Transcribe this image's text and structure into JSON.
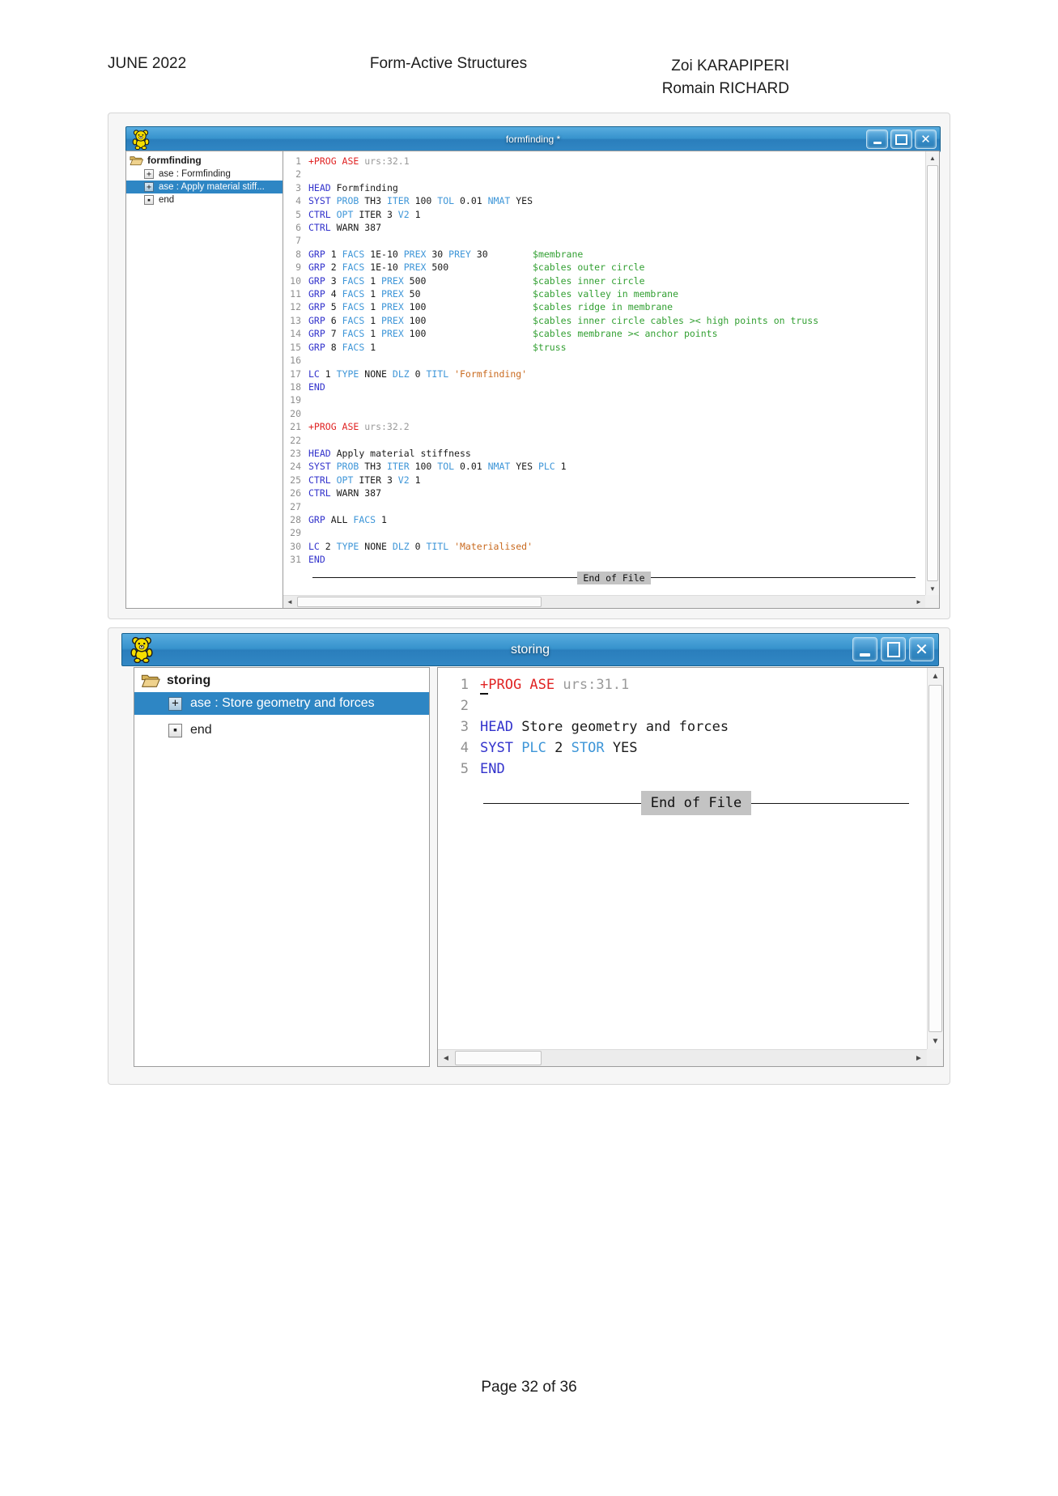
{
  "header": {
    "date": "JUNE 2022",
    "title": "Form-Active Structures",
    "authors": [
      "Zoi KARAPIPERI",
      "Romain RICHARD"
    ]
  },
  "footer": "Page 32 of 36",
  "colors": {
    "titlebar_blue": "#3793cd",
    "selection_blue": "#2e86c4",
    "keyword_primary_blue": "#3333cc",
    "keyword_secondary_blue": "#3e96d8",
    "comment_green": "#33a033",
    "string_orange": "#c96a1f",
    "prog_red": "#e02424",
    "line_number_gray": "#8f8f8f"
  },
  "windows": [
    {
      "title": "formfinding *",
      "controls": [
        "minimize",
        "maximize",
        "close"
      ],
      "eof_label": "End of File",
      "tree": {
        "root": "formfinding",
        "items": [
          {
            "type": "plus",
            "label": "ase : Formfinding",
            "selected": false
          },
          {
            "type": "plus",
            "label": "ase : Apply material stiff...",
            "selected": true
          },
          {
            "type": "dot",
            "label": "end",
            "selected": false
          }
        ]
      },
      "code": [
        {
          "n": 1,
          "t": [
            [
              "+PROG ASE",
              "rd"
            ],
            [
              " urs:32.1",
              "gy"
            ]
          ]
        },
        {
          "n": 2,
          "t": []
        },
        {
          "n": 3,
          "t": [
            [
              "HEAD",
              "k1"
            ],
            [
              " Formfinding",
              "v"
            ]
          ]
        },
        {
          "n": 4,
          "t": [
            [
              "SYST",
              "k1"
            ],
            [
              " PROB",
              "k2"
            ],
            [
              " TH3",
              "v"
            ],
            [
              " ITER",
              "k2"
            ],
            [
              " 100",
              "v"
            ],
            [
              " TOL",
              "k2"
            ],
            [
              " 0.01",
              "v"
            ],
            [
              " NMAT",
              "k2"
            ],
            [
              " YES",
              "v"
            ]
          ]
        },
        {
          "n": 5,
          "t": [
            [
              "CTRL",
              "k1"
            ],
            [
              " OPT",
              "k2"
            ],
            [
              " ITER 3",
              "v"
            ],
            [
              " V2",
              "k2"
            ],
            [
              " 1",
              "v"
            ]
          ]
        },
        {
          "n": 6,
          "t": [
            [
              "CTRL",
              "k1"
            ],
            [
              " WARN 387",
              "v"
            ]
          ]
        },
        {
          "n": 7,
          "t": []
        },
        {
          "n": 8,
          "t": [
            [
              "GRP",
              "k1"
            ],
            [
              " 1",
              "v"
            ],
            [
              " FACS",
              "k2"
            ],
            [
              " 1E-10",
              "v"
            ],
            [
              " PREX",
              "k2"
            ],
            [
              " 30",
              "v"
            ],
            [
              " PREY",
              "k2"
            ],
            [
              " 30",
              "v"
            ],
            [
              "        ",
              "v"
            ],
            [
              "$membrane",
              "gr"
            ]
          ]
        },
        {
          "n": 9,
          "t": [
            [
              "GRP",
              "k1"
            ],
            [
              " 2",
              "v"
            ],
            [
              " FACS",
              "k2"
            ],
            [
              " 1E-10",
              "v"
            ],
            [
              " PREX",
              "k2"
            ],
            [
              " 500",
              "v"
            ],
            [
              "               ",
              "v"
            ],
            [
              "$cables outer circle",
              "gr"
            ]
          ]
        },
        {
          "n": 10,
          "t": [
            [
              "GRP",
              "k1"
            ],
            [
              " 3",
              "v"
            ],
            [
              " FACS",
              "k2"
            ],
            [
              " 1",
              "v"
            ],
            [
              " PREX",
              "k2"
            ],
            [
              " 500",
              "v"
            ],
            [
              "                   ",
              "v"
            ],
            [
              "$cables inner circle",
              "gr"
            ]
          ]
        },
        {
          "n": 11,
          "t": [
            [
              "GRP",
              "k1"
            ],
            [
              " 4",
              "v"
            ],
            [
              " FACS",
              "k2"
            ],
            [
              " 1",
              "v"
            ],
            [
              " PREX",
              "k2"
            ],
            [
              " 50",
              "v"
            ],
            [
              "                    ",
              "v"
            ],
            [
              "$cables valley in membrane",
              "gr"
            ]
          ]
        },
        {
          "n": 12,
          "t": [
            [
              "GRP",
              "k1"
            ],
            [
              " 5",
              "v"
            ],
            [
              " FACS",
              "k2"
            ],
            [
              " 1",
              "v"
            ],
            [
              " PREX",
              "k2"
            ],
            [
              " 100",
              "v"
            ],
            [
              "                   ",
              "v"
            ],
            [
              "$cables ridge in membrane",
              "gr"
            ]
          ]
        },
        {
          "n": 13,
          "t": [
            [
              "GRP",
              "k1"
            ],
            [
              " 6",
              "v"
            ],
            [
              " FACS",
              "k2"
            ],
            [
              " 1",
              "v"
            ],
            [
              " PREX",
              "k2"
            ],
            [
              " 100",
              "v"
            ],
            [
              "                   ",
              "v"
            ],
            [
              "$cables inner circle cables >< high points on truss",
              "gr"
            ]
          ]
        },
        {
          "n": 14,
          "t": [
            [
              "GRP",
              "k1"
            ],
            [
              " 7",
              "v"
            ],
            [
              " FACS",
              "k2"
            ],
            [
              " 1",
              "v"
            ],
            [
              " PREX",
              "k2"
            ],
            [
              " 100",
              "v"
            ],
            [
              "                   ",
              "v"
            ],
            [
              "$cables membrane >< anchor points",
              "gr"
            ]
          ]
        },
        {
          "n": 15,
          "t": [
            [
              "GRP",
              "k1"
            ],
            [
              " 8",
              "v"
            ],
            [
              " FACS",
              "k2"
            ],
            [
              " 1",
              "v"
            ],
            [
              "                            ",
              "v"
            ],
            [
              "$truss",
              "gr"
            ]
          ]
        },
        {
          "n": 16,
          "t": []
        },
        {
          "n": 17,
          "t": [
            [
              "LC",
              "k1"
            ],
            [
              " 1",
              "v"
            ],
            [
              " TYPE",
              "k2"
            ],
            [
              " NONE",
              "v"
            ],
            [
              " DLZ",
              "k2"
            ],
            [
              " 0",
              "v"
            ],
            [
              " TITL",
              "k2"
            ],
            [
              " 'Formfinding'",
              "st"
            ]
          ]
        },
        {
          "n": 18,
          "t": [
            [
              "END",
              "k1"
            ]
          ]
        },
        {
          "n": 19,
          "t": []
        },
        {
          "n": 20,
          "t": []
        },
        {
          "n": 21,
          "t": [
            [
              "+PROG ASE",
              "rd"
            ],
            [
              " urs:32.2",
              "gy"
            ]
          ]
        },
        {
          "n": 22,
          "t": []
        },
        {
          "n": 23,
          "t": [
            [
              "HEAD",
              "k1"
            ],
            [
              " Apply material stiffness",
              "v"
            ]
          ]
        },
        {
          "n": 24,
          "t": [
            [
              "SYST",
              "k1"
            ],
            [
              " PROB",
              "k2"
            ],
            [
              " TH3",
              "v"
            ],
            [
              " ITER",
              "k2"
            ],
            [
              " 100",
              "v"
            ],
            [
              " TOL",
              "k2"
            ],
            [
              " 0.01",
              "v"
            ],
            [
              " NMAT",
              "k2"
            ],
            [
              " YES",
              "v"
            ],
            [
              " PLC",
              "k2"
            ],
            [
              " 1",
              "v"
            ]
          ]
        },
        {
          "n": 25,
          "t": [
            [
              "CTRL",
              "k1"
            ],
            [
              " OPT",
              "k2"
            ],
            [
              " ITER 3",
              "v"
            ],
            [
              " V2",
              "k2"
            ],
            [
              " 1",
              "v"
            ]
          ]
        },
        {
          "n": 26,
          "t": [
            [
              "CTRL",
              "k1"
            ],
            [
              " WARN 387",
              "v"
            ]
          ]
        },
        {
          "n": 27,
          "t": []
        },
        {
          "n": 28,
          "t": [
            [
              "GRP",
              "k1"
            ],
            [
              " ALL",
              "v"
            ],
            [
              " FACS",
              "k2"
            ],
            [
              " 1",
              "v"
            ]
          ]
        },
        {
          "n": 29,
          "t": []
        },
        {
          "n": 30,
          "t": [
            [
              "LC",
              "k1"
            ],
            [
              " 2",
              "v"
            ],
            [
              " TYPE",
              "k2"
            ],
            [
              " NONE",
              "v"
            ],
            [
              " DLZ",
              "k2"
            ],
            [
              " 0",
              "v"
            ],
            [
              " TITL",
              "k2"
            ],
            [
              " 'Materialised'",
              "st"
            ]
          ]
        },
        {
          "n": 31,
          "t": [
            [
              "END",
              "k1"
            ]
          ]
        }
      ]
    },
    {
      "title": "storing",
      "controls": [
        "minimize",
        "maximize",
        "close"
      ],
      "eof_label": "End of File",
      "tree": {
        "root": "storing",
        "items": [
          {
            "type": "plus",
            "label": "ase : Store geometry and forces",
            "selected": true
          },
          {
            "type": "dot",
            "label": "end",
            "selected": false
          }
        ]
      },
      "code": [
        {
          "n": 1,
          "t": [
            [
              "+",
              "rd cur"
            ],
            [
              "PROG ASE",
              "rd"
            ],
            [
              " urs:31.1",
              "gy"
            ]
          ]
        },
        {
          "n": 2,
          "t": []
        },
        {
          "n": 3,
          "t": [
            [
              "HEAD",
              "k1"
            ],
            [
              " Store geometry and forces",
              "v"
            ]
          ]
        },
        {
          "n": 4,
          "t": [
            [
              "SYST",
              "k1"
            ],
            [
              " PLC",
              "k2"
            ],
            [
              " 2",
              "v"
            ],
            [
              " STOR",
              "k2"
            ],
            [
              " YES",
              "v"
            ]
          ]
        },
        {
          "n": 5,
          "t": [
            [
              "END",
              "k1"
            ]
          ]
        }
      ]
    }
  ]
}
